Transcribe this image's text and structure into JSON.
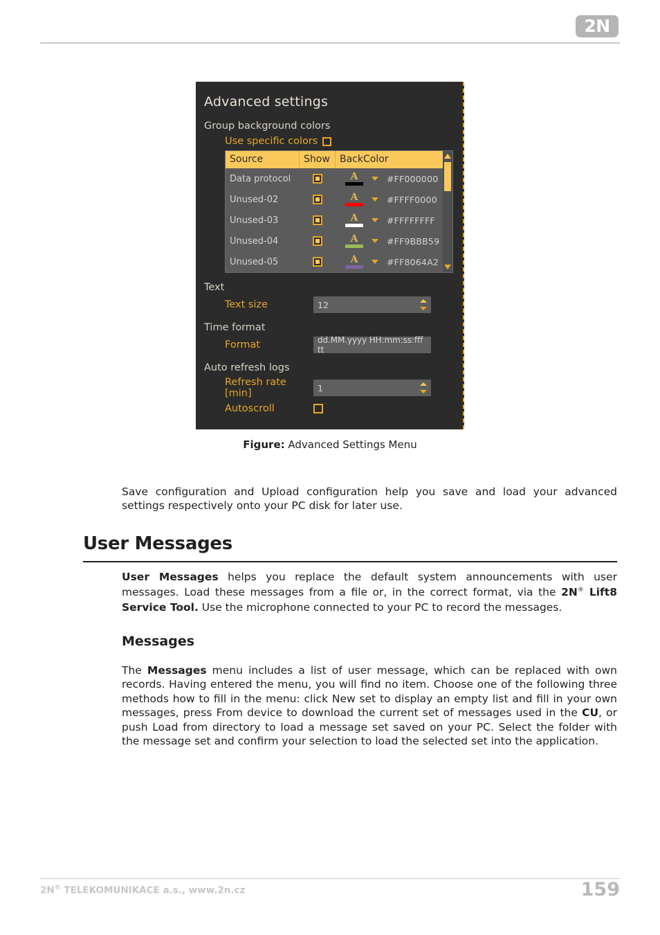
{
  "page": {
    "logo_text": "2N",
    "page_number": "159",
    "footer_company": "2N",
    "footer_company_sup": "®",
    "footer_rest": " TELEKOMUNIKACE a.s., www.2n.cz"
  },
  "figure": {
    "caption_label": "Figure:",
    "caption_text": "Advanced Settings Menu"
  },
  "dialog": {
    "title": "Advanced settings",
    "group_background_colors_label": "Group background colors",
    "use_specific_colors_label": "Use specific colors",
    "use_specific_colors_checked": false,
    "table": {
      "columns": [
        "Source",
        "Show",
        "BackColor"
      ],
      "rows": [
        {
          "source": "Data protocol",
          "show": true,
          "swatch_glyph": "A",
          "swatch_color": "#000000",
          "hex": "#FF000000"
        },
        {
          "source": "Unused-02",
          "show": true,
          "swatch_glyph": "A",
          "swatch_color": "#FF0000",
          "hex": "#FFFF0000"
        },
        {
          "source": "Unused-03",
          "show": true,
          "swatch_glyph": "A",
          "swatch_color": "#FFFFFF",
          "hex": "#FFFFFFFF"
        },
        {
          "source": "Unused-04",
          "show": true,
          "swatch_glyph": "A",
          "swatch_color": "#9BBB59",
          "hex": "#FF9BBB59"
        },
        {
          "source": "Unused-05",
          "show": true,
          "swatch_glyph": "A",
          "swatch_color": "#8064A2",
          "hex": "#FF8064A2"
        }
      ]
    },
    "text_section_label": "Text",
    "text_size_label": "Text size",
    "text_size_value": "12",
    "time_format_section_label": "Time format",
    "format_label": "Format",
    "format_value": "dd.MM.yyyy HH:mm:ss:fff tt",
    "auto_refresh_section_label": "Auto refresh logs",
    "refresh_rate_label": "Refresh rate [min]",
    "refresh_rate_value": "1",
    "autoscroll_label": "Autoscroll",
    "autoscroll_checked": false,
    "accent_color": "#E5A72A",
    "header_color": "#FBC95B",
    "background_color": "#2B2B2B"
  },
  "body": {
    "para_save_config": "Save configuration and Upload configuration help you save and load your advanced settings respectively onto your PC disk for later use.",
    "section_title": "User Messages",
    "para_user_messages": {
      "bold_1": "User Messages",
      "text_1": " helps you replace the default system announcements with user messages. Load these messages from a file or, in the correct format, via the ",
      "bold_2": "2N",
      "sup_2": "®",
      "bold_3": " Lift8 Service Tool.",
      "text_2": " Use the microphone connected to your PC to record the messages."
    },
    "subsection_title": "Messages",
    "para_messages": {
      "text_1": "The ",
      "bold_1": "Messages",
      "text_2": " menu includes a list of user message, which can be replaced with own records. Having entered the menu, you will find no item. Choose one of the following three methods how to fill in the menu: click New set to display an empty list and fill in your own messages, press From device to download the current set of messages used in the ",
      "bold_2": "CU",
      "text_3": ", or push Load from directory to load a message set saved on your PC. Select the folder with the message set and confirm your selection to load the selected set into the application."
    }
  }
}
